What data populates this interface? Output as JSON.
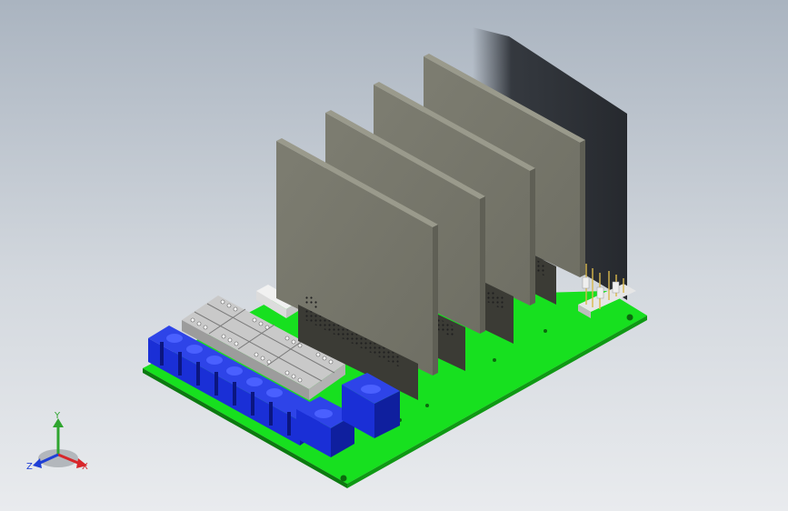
{
  "viewport": {
    "background_top": "#aab4c0",
    "background_bottom": "#e9ebee"
  },
  "model": {
    "pcb_color": "#17e01f",
    "card_color": "#7a7a6e",
    "connector_color": "#1a2fd6",
    "terminal_color": "#c9c9c9",
    "shadow_color": "#2e3238",
    "card_count": 4
  },
  "triad": {
    "x_label": "X",
    "y_label": "Y",
    "z_label": "Z",
    "x_color": "#d8262b",
    "y_color": "#2fa52f",
    "z_color": "#1f3fd6"
  }
}
